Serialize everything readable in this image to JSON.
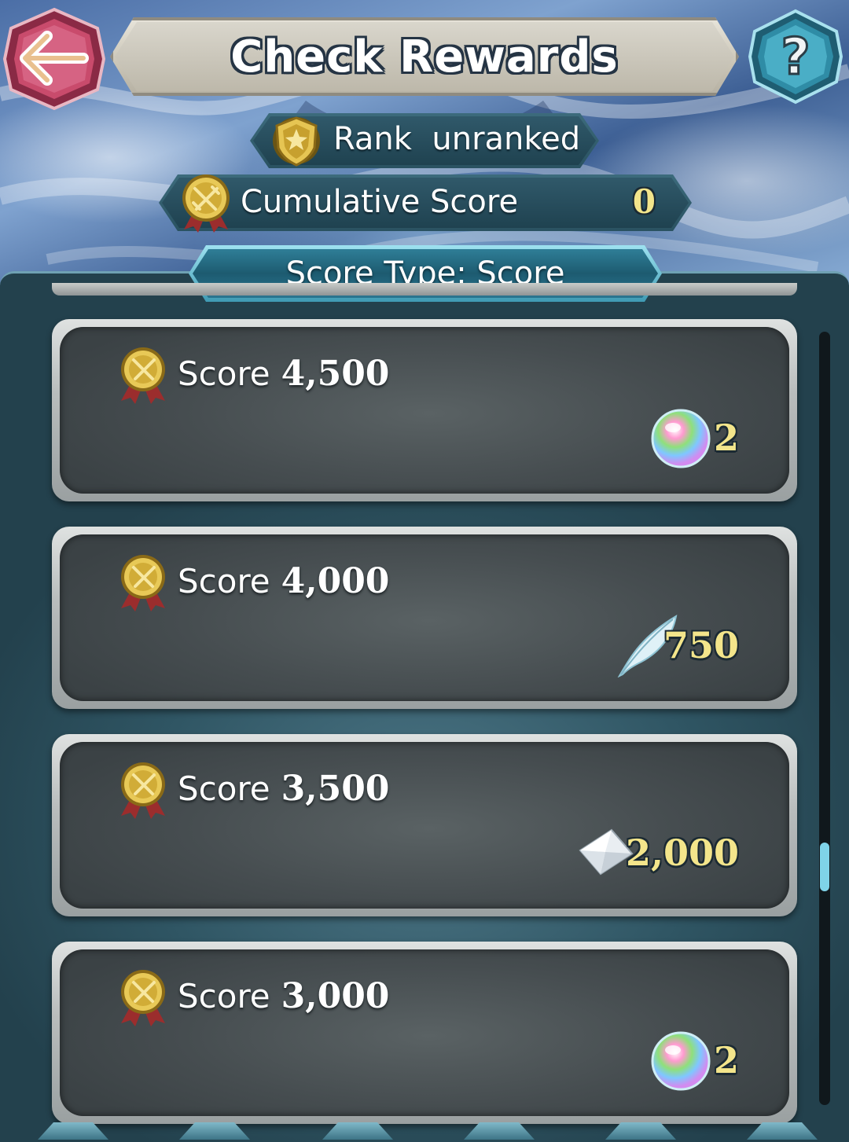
{
  "header": {
    "title": "Check Rewards",
    "back_icon": "back-arrow-icon",
    "help_icon": "question-mark-icon",
    "help_label": "?"
  },
  "rank": {
    "label": "Rank",
    "value": "unranked",
    "icon": "rank-shield-icon"
  },
  "cumulative": {
    "label": "Cumulative Score",
    "value": "0",
    "icon": "score-medal-icon"
  },
  "score_type": {
    "label": "Score Type: Score"
  },
  "rewards": [
    {
      "label": "Score",
      "value": "4,500",
      "reward_icon": "orb-icon",
      "quantity": "2"
    },
    {
      "label": "Score",
      "value": "4,000",
      "reward_icon": "feather-icon",
      "quantity": "750"
    },
    {
      "label": "Score",
      "value": "3,500",
      "reward_icon": "crystal-icon",
      "quantity": "2,000"
    },
    {
      "label": "Score",
      "value": "3,000",
      "reward_icon": "orb-icon",
      "quantity": "2"
    }
  ],
  "colors": {
    "accent_gold": "#f3e58b",
    "panel_teal": "#2f5563",
    "tab_cyan": "#3f9bb4"
  }
}
